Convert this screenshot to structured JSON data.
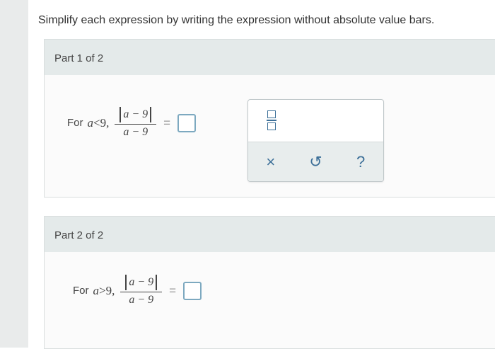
{
  "instructions": "Simplify each expression by writing the expression without absolute value bars.",
  "parts": [
    {
      "title": "Part 1 of 2",
      "condition_prefix": "For",
      "variable": "a",
      "relation": "<",
      "bound": "9,",
      "numerator": "a − 9",
      "denominator": "a − 9",
      "equals": "=",
      "answer": ""
    },
    {
      "title": "Part 2 of 2",
      "condition_prefix": "For",
      "variable": "a",
      "relation": ">",
      "bound": "9,",
      "numerator": "a − 9",
      "denominator": "a − 9",
      "equals": "=",
      "answer": ""
    }
  ],
  "palette": {
    "template_icon": "fraction-template-icon",
    "tools": [
      {
        "icon": "clear-icon",
        "glyph": "×"
      },
      {
        "icon": "undo-icon",
        "glyph": "↺"
      },
      {
        "icon": "help-icon",
        "glyph": "?"
      }
    ]
  },
  "colors": {
    "accent": "#3c6f98",
    "answer_box_border": "#7da9c0",
    "part_header_bg": "#e4eaea"
  }
}
